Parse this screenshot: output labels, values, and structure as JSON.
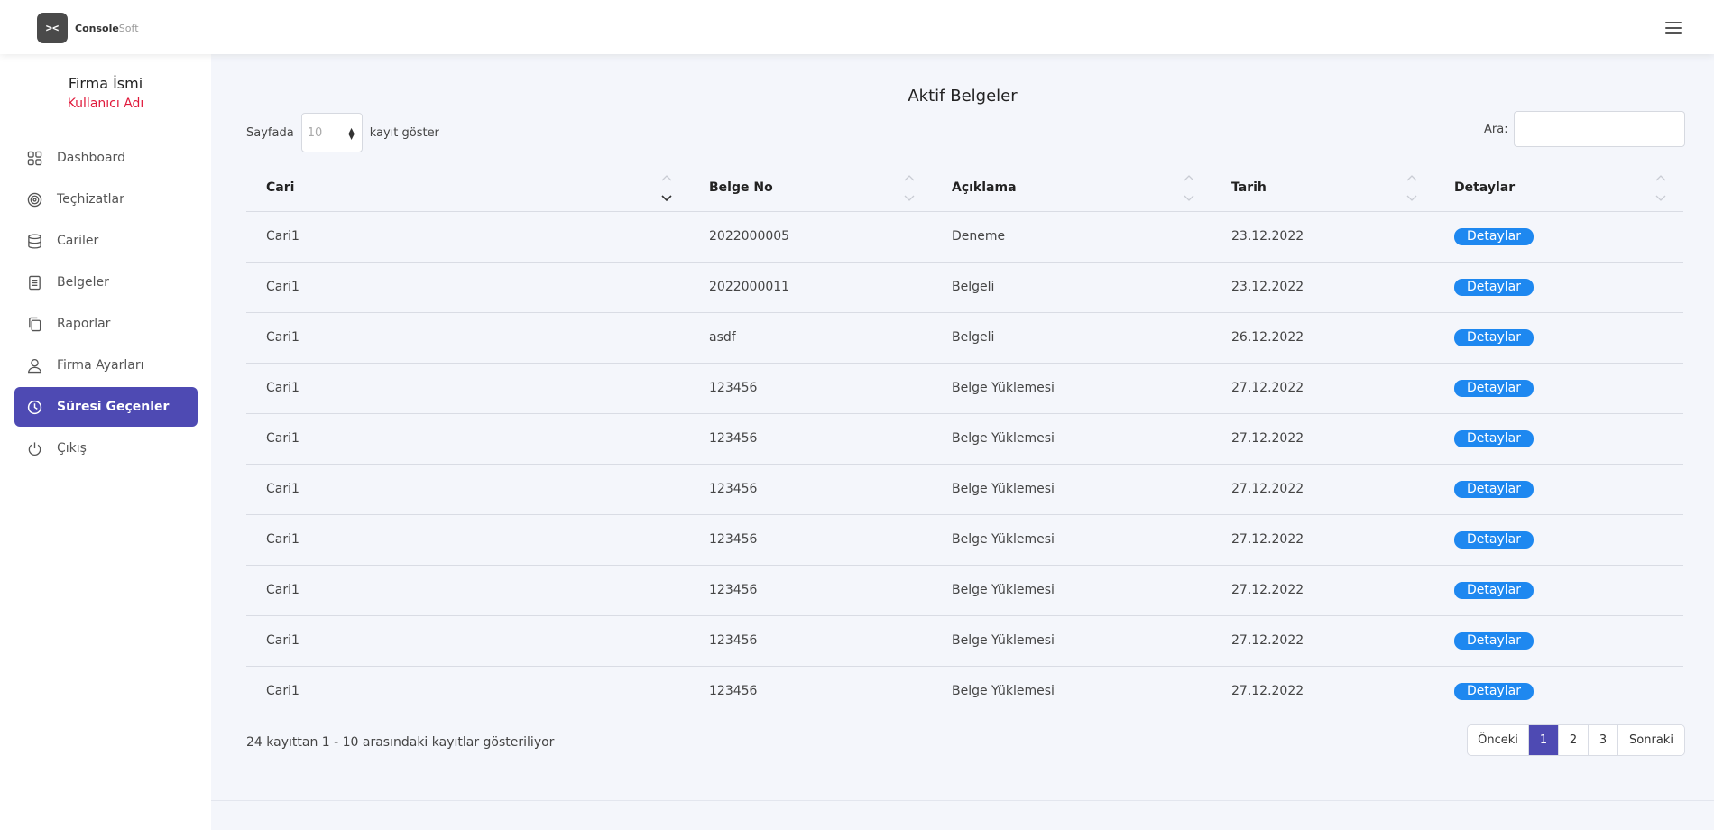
{
  "app": {
    "brand_bold": "Console",
    "brand_light": "Soft",
    "logo_glyph": "><"
  },
  "sidebar": {
    "firm_name": "Firma İsmi",
    "user_name": "Kullanıcı Adı",
    "items": [
      {
        "label": "Dashboard",
        "icon": "grid-icon"
      },
      {
        "label": "Teçhizatlar",
        "icon": "target-icon"
      },
      {
        "label": "Cariler",
        "icon": "database-icon"
      },
      {
        "label": "Belgeler",
        "icon": "document-icon"
      },
      {
        "label": "Raporlar",
        "icon": "copy-icon"
      },
      {
        "label": "Firma Ayarları",
        "icon": "user-icon"
      },
      {
        "label": "Süresi Geçenler",
        "icon": "clock-icon",
        "active": true
      },
      {
        "label": "Çıkış",
        "icon": "power-icon"
      }
    ]
  },
  "main": {
    "title": "Aktif Belgeler",
    "length_prefix": "Sayfada",
    "length_value": "10",
    "length_suffix": "kayıt göster",
    "search_label": "Ara:",
    "search_value": "",
    "columns": [
      "Cari",
      "Belge No",
      "Açıklama",
      "Tarih",
      "Detaylar"
    ],
    "rows": [
      {
        "cari": "Cari1",
        "belge_no": "2022000005",
        "aciklama": "Deneme",
        "tarih": "23.12.2022",
        "detay": "Detaylar"
      },
      {
        "cari": "Cari1",
        "belge_no": "2022000011",
        "aciklama": "Belgeli",
        "tarih": "23.12.2022",
        "detay": "Detaylar"
      },
      {
        "cari": "Cari1",
        "belge_no": "asdf",
        "aciklama": "Belgeli",
        "tarih": "26.12.2022",
        "detay": "Detaylar"
      },
      {
        "cari": "Cari1",
        "belge_no": "123456",
        "aciklama": "Belge Yüklemesi",
        "tarih": "27.12.2022",
        "detay": "Detaylar"
      },
      {
        "cari": "Cari1",
        "belge_no": "123456",
        "aciklama": "Belge Yüklemesi",
        "tarih": "27.12.2022",
        "detay": "Detaylar"
      },
      {
        "cari": "Cari1",
        "belge_no": "123456",
        "aciklama": "Belge Yüklemesi",
        "tarih": "27.12.2022",
        "detay": "Detaylar"
      },
      {
        "cari": "Cari1",
        "belge_no": "123456",
        "aciklama": "Belge Yüklemesi",
        "tarih": "27.12.2022",
        "detay": "Detaylar"
      },
      {
        "cari": "Cari1",
        "belge_no": "123456",
        "aciklama": "Belge Yüklemesi",
        "tarih": "27.12.2022",
        "detay": "Detaylar"
      },
      {
        "cari": "Cari1",
        "belge_no": "123456",
        "aciklama": "Belge Yüklemesi",
        "tarih": "27.12.2022",
        "detay": "Detaylar"
      },
      {
        "cari": "Cari1",
        "belge_no": "123456",
        "aciklama": "Belge Yüklemesi",
        "tarih": "27.12.2022",
        "detay": "Detaylar"
      }
    ],
    "info": "24 kayıttan 1 - 10 arasındaki kayıtlar gösteriliyor",
    "pagination": {
      "prev": "Önceki",
      "pages": [
        "1",
        "2",
        "3"
      ],
      "current": "1",
      "next": "Sonraki"
    }
  },
  "colors": {
    "accent": "#4e4ab3",
    "badge": "#1e88f0",
    "user_name": "#e0193b"
  }
}
